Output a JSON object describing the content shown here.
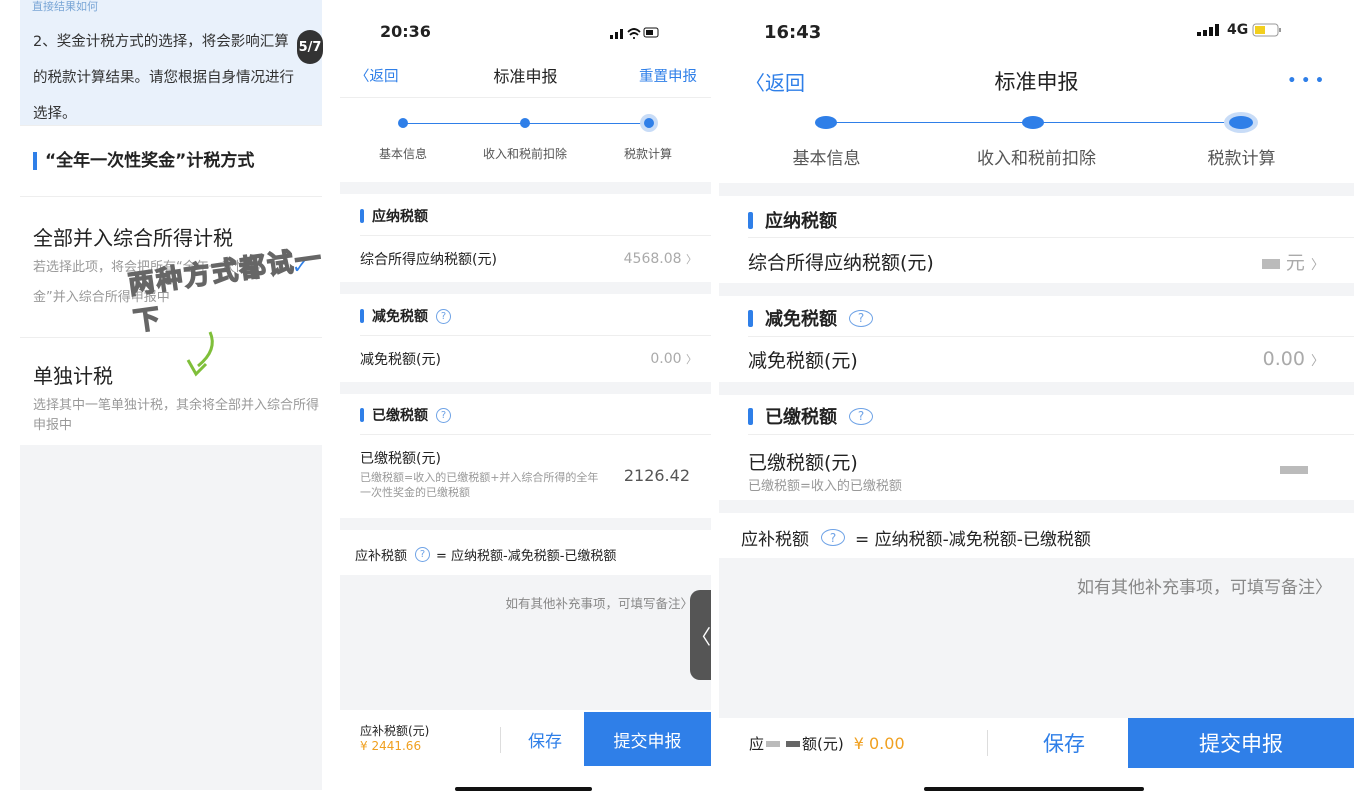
{
  "left_panel": {
    "top_note_fragment": "直接结果如何",
    "note_text": "2、奖金计税方式的选择，将会影响汇算的税款计算结果。请您根据自身情况进行选择。",
    "page_badge": "5/7",
    "section_heading": "“全年一次性奖金”计税方式",
    "option_merge": {
      "title": "全部并入综合所得计税",
      "subtitle": "若选择此项，将会把所有“全年一次性奖金”并入综合所得申报中",
      "checkmark": "✓"
    },
    "option_separate": {
      "title": "单独计税",
      "subtitle": "选择其中一笔单独计税，其余将全部并入综合所得申报中"
    },
    "overlay_doodle_text": "两种方式都试一下"
  },
  "phone_a": {
    "status": {
      "time": "20:36",
      "signal_icon": "signal-icon",
      "wifi_icon": "wifi-icon",
      "battery_icon": "battery-icon"
    },
    "nav": {
      "back": "〈返回",
      "title": "标准申报",
      "reset": "重置申报"
    },
    "steps": [
      "基本信息",
      "收入和税前扣除",
      "税款计算"
    ],
    "section_payable": {
      "title": "应纳税额",
      "row_label": "综合所得应纳税额(元)",
      "row_value": "4568.08",
      "chevron": "〉"
    },
    "section_relief": {
      "title": "减免税额",
      "help": "?",
      "row_label": "减免税额(元)",
      "row_value": "0.00",
      "chevron": "〉"
    },
    "section_paid": {
      "title": "已缴税额",
      "help": "?",
      "row_label": "已缴税额(元)",
      "row_hint": "已缴税额=收入的已缴税额+并入综合所得的全年一次性奖金的已缴税额",
      "row_value": "2126.42"
    },
    "formula": {
      "label": "应补税额",
      "help": "?",
      "expr": "= 应纳税额-减免税额-已缴税额"
    },
    "remark_hint": "如有其他补充事项，可填写备注〉",
    "footer": {
      "due_label": "应补税额(元)",
      "due_value": "¥ 2441.66",
      "save": "保存",
      "submit": "提交申报"
    },
    "side_tab": "〈"
  },
  "phone_b": {
    "status": {
      "time": "16:43",
      "network": "4G",
      "signal_icon": "signal-icon",
      "battery_icon": "battery-icon"
    },
    "nav": {
      "back": "〈返回",
      "title": "标准申报",
      "more": "• • •"
    },
    "steps": [
      "基本信息",
      "收入和税前扣除",
      "税款计算"
    ],
    "section_payable": {
      "title": "应纳税额",
      "row_label": "综合所得应纳税额(元)",
      "row_value_suffix": "元",
      "chevron": "〉"
    },
    "section_relief": {
      "title": "减免税额",
      "help": "?",
      "row_label": "减免税额(元)",
      "row_value": "0.00",
      "chevron": "〉"
    },
    "section_paid": {
      "title": "已缴税额",
      "help": "?",
      "row_label": "已缴税额(元)",
      "row_hint": "已缴税额=收入的已缴税额"
    },
    "formula": {
      "label": "应补税额",
      "help": "?",
      "expr": "= 应纳税额-减免税额-已缴税额"
    },
    "remark_hint": "如有其他补充事项，可填写备注〉",
    "footer": {
      "due_prefix": "应",
      "due_suffix": "额(元)",
      "due_value": "¥ 0.00",
      "save": "保存",
      "submit": "提交申报"
    }
  },
  "colors": {
    "accent": "#2f7fe8",
    "due_amount": "#f0a020",
    "background_gray": "#f3f4f6"
  }
}
